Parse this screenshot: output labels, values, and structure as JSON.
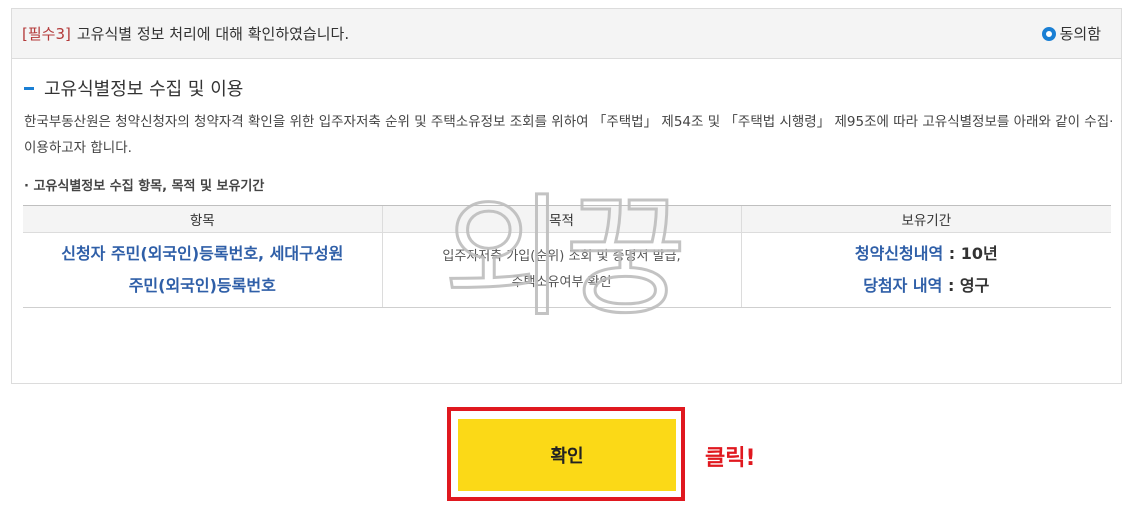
{
  "header": {
    "tag": "[필수3]",
    "title": "고유식별 정보 처리에 대해 확인하였습니다.",
    "agree_label": "동의함"
  },
  "section": {
    "title": "고유식별정보 수집 및 이용",
    "description": "한국부동산원은 청약신청자의 청약자격 확인을 위한 입주자저축 순위 및 주택소유정보 조회를 위하여 「주택법」 제54조 및 「주택법 시행령」 제95조에 따라 고유식별정보를 아래와 같이 수집·이용하고자 합니다.",
    "subheading": "· 고유식별정보 수집 항목, 목적 및 보유기간"
  },
  "table": {
    "headers": [
      "항목",
      "목적",
      "보유기간"
    ],
    "item_line1": "신청자 주민(외국인)등록번호, 세대구성원",
    "item_line2": "주민(외국인)등록번호",
    "purpose_line1": "입주자저축 가입(순위) 조회 및 증명서 발급,",
    "purpose_line2": "주택소유여부 확인",
    "retention1_label": "청약신청내역",
    "retention1_value": " : 10년",
    "retention2_label": "당첨자 내역",
    "retention2_value": " : 영구"
  },
  "watermark": {
    "text": "외꿍"
  },
  "confirm_button": {
    "label": "확인"
  },
  "annotation": {
    "text": "클릭!"
  },
  "colors": {
    "accent_blue": "#1a7fd4",
    "button_yellow": "#fbd917",
    "highlight_red": "#e0181f"
  }
}
